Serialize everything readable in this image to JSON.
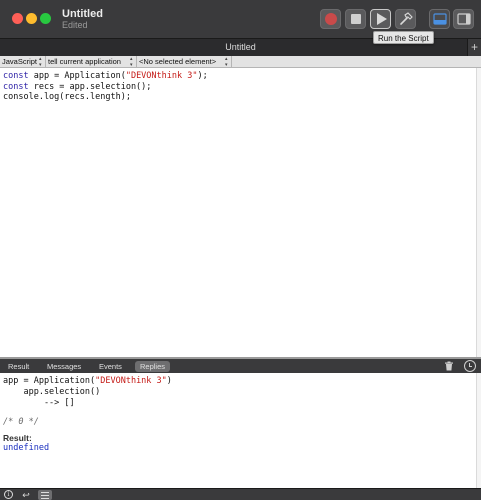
{
  "window": {
    "title": "Untitled",
    "subtitle": "Edited",
    "tab_title": "Untitled",
    "new_tab_symbol": "+"
  },
  "toolbar": {
    "buttons": [
      {
        "name": "record-button",
        "icon": "record-icon"
      },
      {
        "name": "stop-button",
        "icon": "stop-icon"
      },
      {
        "name": "run-button",
        "icon": "play-icon"
      },
      {
        "name": "compile-button",
        "icon": "hammer-icon"
      },
      {
        "name": "show-log-button",
        "icon": "bottom-pane-icon"
      },
      {
        "name": "show-library-button",
        "icon": "side-pane-icon"
      }
    ],
    "tooltip": "Run the Script"
  },
  "navbar": {
    "language": "JavaScript",
    "target": "tell current application",
    "element": "<No selected element>"
  },
  "editor": {
    "lines": [
      [
        {
          "t": "const",
          "c": "kw"
        },
        {
          "t": " app = Application(",
          "c": ""
        },
        {
          "t": "\"DEVONthink 3\"",
          "c": "str"
        },
        {
          "t": ");",
          "c": ""
        }
      ],
      [
        {
          "t": "const",
          "c": "kw"
        },
        {
          "t": " recs = app.selection();",
          "c": ""
        }
      ],
      [
        {
          "t": "console.log(recs.length);",
          "c": ""
        }
      ]
    ]
  },
  "log_tabs": {
    "result": "Result",
    "messages": "Messages",
    "events": "Events",
    "replies": "Replies",
    "selected": "Replies"
  },
  "log": {
    "line1_a": "app = Application(",
    "line1_b": "\"DEVONthink 3\"",
    "line1_c": ")",
    "line2": "    app.selection()",
    "line3": "        --> []",
    "comment": "/* 0 */",
    "result_label": "Result:",
    "result_value": "undefined"
  },
  "colors": {
    "keyword": "#2b1fa6",
    "string": "#c41a16",
    "result_value": "#1a2fbf",
    "record": "#c94a4a"
  }
}
